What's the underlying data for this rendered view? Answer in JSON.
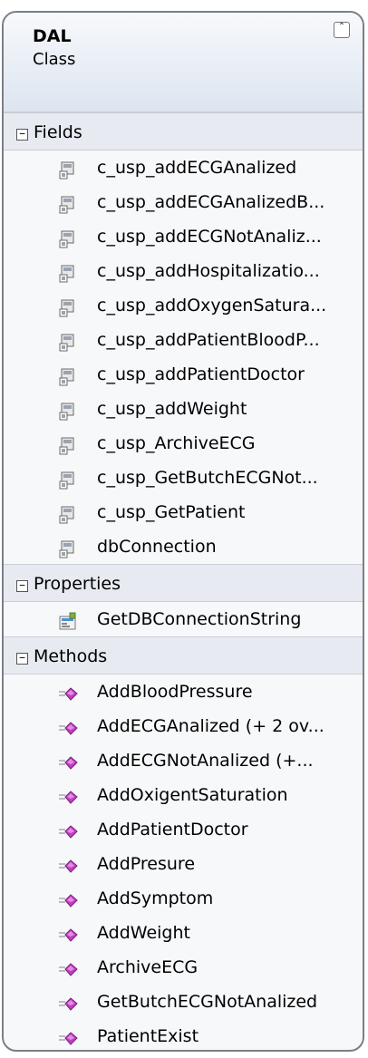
{
  "class": {
    "name": "DAL",
    "stereotype": "Class",
    "collapse_glyph": "⌃"
  },
  "sections": {
    "fields": {
      "title": "Fields",
      "toggle": "−",
      "items": [
        "c_usp_addECGAnalized",
        "c_usp_addECGAnalizedB...",
        "c_usp_addECGNotAnaliz...",
        "c_usp_addHospitalizatio...",
        "c_usp_addOxygenSatura...",
        "c_usp_addPatientBloodP...",
        "c_usp_addPatientDoctor",
        "c_usp_addWeight",
        "c_usp_ArchiveECG",
        "c_usp_GetButchECGNot...",
        "c_usp_GetPatient",
        "dbConnection"
      ]
    },
    "properties": {
      "title": "Properties",
      "toggle": "−",
      "items": [
        "GetDBConnectionString"
      ]
    },
    "methods": {
      "title": "Methods",
      "toggle": "−",
      "items": [
        "AddBloodPressure",
        "AddECGAnalized (+ 2 ov...",
        "AddECGNotAnalized (+...",
        "AddOxigentSaturation",
        "AddPatientDoctor",
        "AddPresure",
        "AddSymptom",
        "AddWeight",
        "ArchiveECG",
        "GetButchECGNotAnalized",
        "PatientExist"
      ]
    }
  },
  "colors": {
    "border": "#7a7f88",
    "method_icon": "#c040c0",
    "field_icon": "#6a6a6a"
  }
}
